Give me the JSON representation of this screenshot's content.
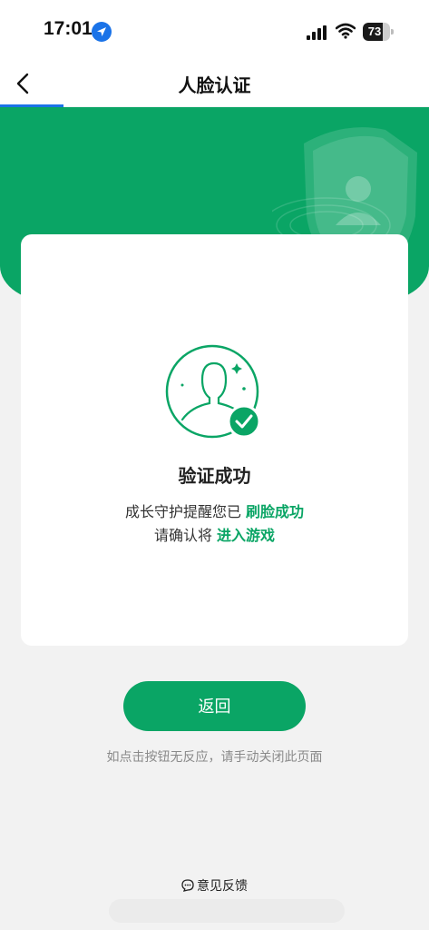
{
  "status_bar": {
    "time": "17:01",
    "battery_level": "73",
    "battery_fraction": 0.73,
    "icons": [
      "location-arrow-icon",
      "cellular-signal-icon",
      "wifi-icon",
      "battery-icon"
    ]
  },
  "nav": {
    "title": "人脸认证",
    "back_icon": "chevron-left-icon"
  },
  "colors": {
    "brand_green": "#0aa565",
    "link_blue": "#1a73e8",
    "background": "#f2f2f2"
  },
  "result": {
    "icon": "face-verified-check-icon",
    "title": "验证成功",
    "line1_prefix": "成长守护提醒您已",
    "line1_highlight": "刷脸成功",
    "line2_prefix": "请确认将",
    "line2_highlight": "进入游戏"
  },
  "actions": {
    "return_label": "返回",
    "hint": "如点击按钮无反应，请手动关闭此页面"
  },
  "footer": {
    "feedback_label": "意见反馈",
    "feedback_icon": "chat-bubble-icon"
  }
}
